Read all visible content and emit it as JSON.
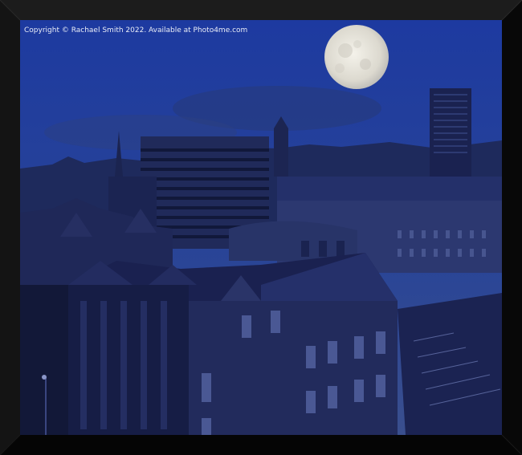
{
  "copyright": "Copyright © Rachael Smith 2022. Available at Photo4me.com",
  "colors": {
    "frame": "#0d0d0d",
    "sky_top": "#1f3a9a",
    "sky_bottom": "#243f8e",
    "moon": "#e9e6dc",
    "buildings_dark": "#141c3e",
    "buildings_mid": "#2a3566"
  }
}
